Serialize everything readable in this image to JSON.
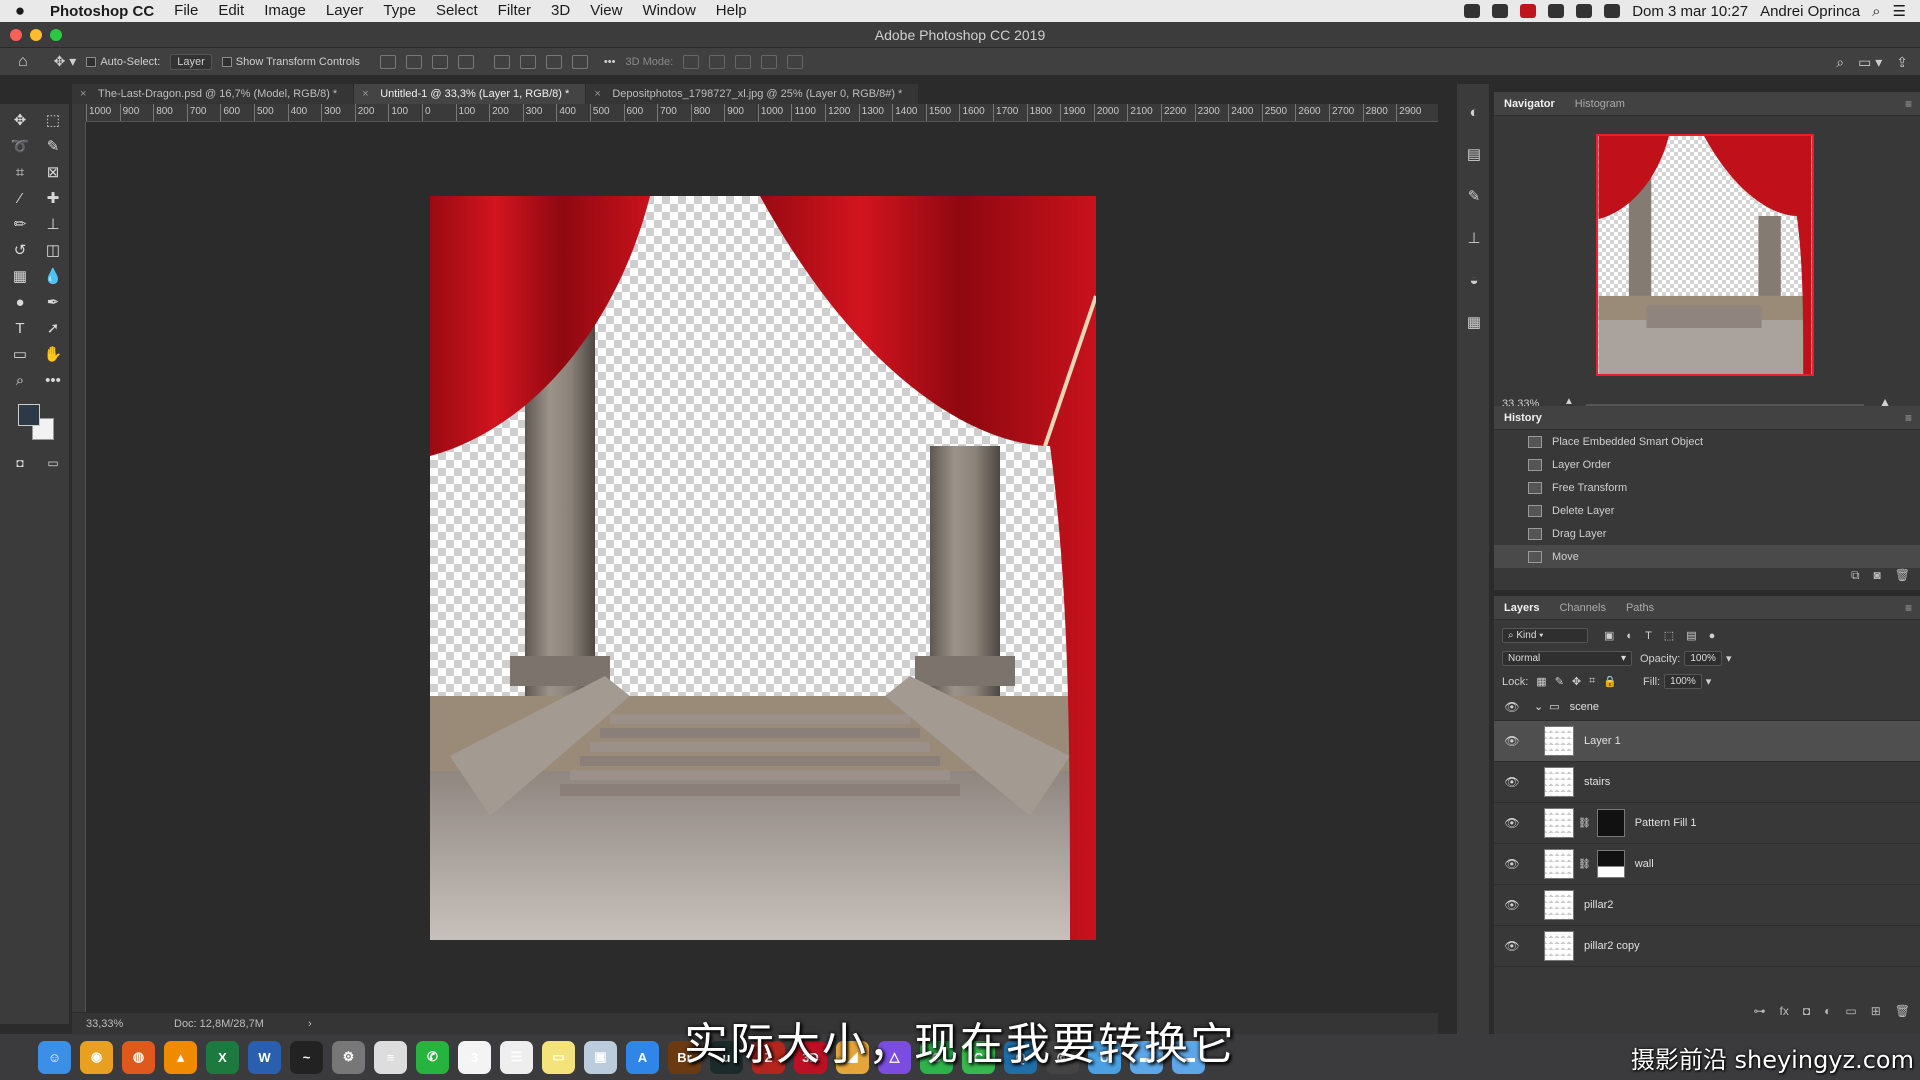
{
  "menubar": {
    "app_name": "Photoshop CC",
    "items": [
      "File",
      "Edit",
      "Image",
      "Layer",
      "Type",
      "Select",
      "Filter",
      "3D",
      "View",
      "Window",
      "Help"
    ],
    "datetime": "Dom 3 mar 10:27",
    "user": "Andrei Oprinca"
  },
  "window": {
    "title": "Adobe Photoshop CC 2019"
  },
  "options_bar": {
    "auto_select_label": "Auto-Select:",
    "auto_select_value": "Layer",
    "transform_label": "Show Transform Controls",
    "mode_label": "3D Mode:"
  },
  "tabs": [
    {
      "label": "The-Last-Dragon.psd @ 16,7% (Model, RGB/8) *",
      "active": false
    },
    {
      "label": "Untitled-1 @ 33,3% (Layer 1, RGB/8) *",
      "active": true
    },
    {
      "label": "Depositphotos_1798727_xl.jpg @ 25% (Layer 0, RGB/8#) *",
      "active": false
    }
  ],
  "ruler_ticks": [
    "1000",
    "900",
    "800",
    "700",
    "600",
    "500",
    "400",
    "300",
    "200",
    "100",
    "0",
    "100",
    "200",
    "300",
    "400",
    "500",
    "600",
    "700",
    "800",
    "900",
    "1000",
    "1100",
    "1200",
    "1300",
    "1400",
    "1500",
    "1600",
    "1700",
    "1800",
    "1900",
    "2000",
    "2100",
    "2200",
    "2300",
    "2400",
    "2500",
    "2600",
    "2700",
    "2800",
    "2900"
  ],
  "status": {
    "zoom": "33,33%",
    "doc": "Doc: 12,8M/28,7M"
  },
  "navigator": {
    "tabs": [
      "Navigator",
      "Histogram"
    ],
    "zoom": "33,33%",
    "zoom_level": 0.38
  },
  "history": {
    "title": "History",
    "items": [
      {
        "label": "Place Embedded Smart Object",
        "selected": false
      },
      {
        "label": "Layer Order",
        "selected": false
      },
      {
        "label": "Free Transform",
        "selected": false
      },
      {
        "label": "Delete Layer",
        "selected": false
      },
      {
        "label": "Drag Layer",
        "selected": false
      },
      {
        "label": "Move",
        "selected": true
      }
    ]
  },
  "layers_panel": {
    "tabs": [
      "Layers",
      "Channels",
      "Paths"
    ],
    "filter": "Kind",
    "blend_mode": "Normal",
    "opacity_label": "Opacity:",
    "opacity": "100%",
    "lock_label": "Lock:",
    "fill_label": "Fill:",
    "fill": "100%",
    "group": "scene",
    "layers": [
      {
        "name": "Layer 1",
        "selected": true,
        "mask": false
      },
      {
        "name": "stairs",
        "selected": false,
        "mask": false
      },
      {
        "name": "Pattern Fill 1",
        "selected": false,
        "mask": true
      },
      {
        "name": "wall",
        "selected": false,
        "mask": true
      },
      {
        "name": "pillar2",
        "selected": false,
        "mask": false
      },
      {
        "name": "pillar2 copy",
        "selected": false,
        "mask": false
      }
    ]
  },
  "dock": {
    "apps": [
      {
        "name": "Finder",
        "color": "#3b8fe6",
        "glyph": "☺"
      },
      {
        "name": "Chrome",
        "color": "#e8a020",
        "glyph": "◉"
      },
      {
        "name": "Firefox",
        "color": "#e0591c",
        "glyph": "◍"
      },
      {
        "name": "VLC",
        "color": "#f08a00",
        "glyph": "▲"
      },
      {
        "name": "Excel",
        "color": "#1d7a3f",
        "glyph": "X"
      },
      {
        "name": "Word",
        "color": "#2a5fb0",
        "glyph": "W"
      },
      {
        "name": "Activity Monitor",
        "color": "#222",
        "glyph": "~"
      },
      {
        "name": "System Preferences",
        "color": "#777",
        "glyph": "⚙"
      },
      {
        "name": "Notes",
        "color": "#ddd",
        "glyph": "≡"
      },
      {
        "name": "WhatsApp",
        "color": "#27b43e",
        "glyph": "✆"
      },
      {
        "name": "Calendar",
        "color": "#f4f4f4",
        "glyph": "3"
      },
      {
        "name": "Reminders",
        "color": "#eee",
        "glyph": "☰"
      },
      {
        "name": "Stickies",
        "color": "#f3e37a",
        "glyph": "▭"
      },
      {
        "name": "Preview",
        "color": "#bcd",
        "glyph": "▣"
      },
      {
        "name": "App Store",
        "color": "#2f86e8",
        "glyph": "A"
      },
      {
        "name": "Bridge",
        "color": "#6b3a12",
        "glyph": "Br"
      },
      {
        "name": "Upwork",
        "color": "#1b2b2b",
        "glyph": "u"
      },
      {
        "name": "FileZilla",
        "color": "#b3261e",
        "glyph": "Z"
      },
      {
        "name": "3DS",
        "color": "#b12",
        "glyph": "3D"
      },
      {
        "name": "Keka",
        "color": "#e4a63b",
        "glyph": "◢"
      },
      {
        "name": "Affinity",
        "color": "#7a4de0",
        "glyph": "△"
      },
      {
        "name": "Camtasia",
        "color": "#2eb34b",
        "glyph": "C"
      },
      {
        "name": "Camtasia 2",
        "color": "#36b84c",
        "glyph": "C"
      },
      {
        "name": "QuickTime",
        "color": "#1f6ea8",
        "glyph": "Q"
      },
      {
        "name": "Aperture",
        "color": "#444",
        "glyph": "◎"
      },
      {
        "name": "Utility",
        "color": "#4aa0e0",
        "glyph": "U"
      },
      {
        "name": "Folder",
        "color": "#5da7e8",
        "glyph": "▬"
      },
      {
        "name": "Folder 2",
        "color": "#5da7e8",
        "glyph": "▬"
      }
    ]
  },
  "subtitle": "实际大小，现在我要转换它",
  "watermark": "摄影前沿 sheyingyz.com"
}
